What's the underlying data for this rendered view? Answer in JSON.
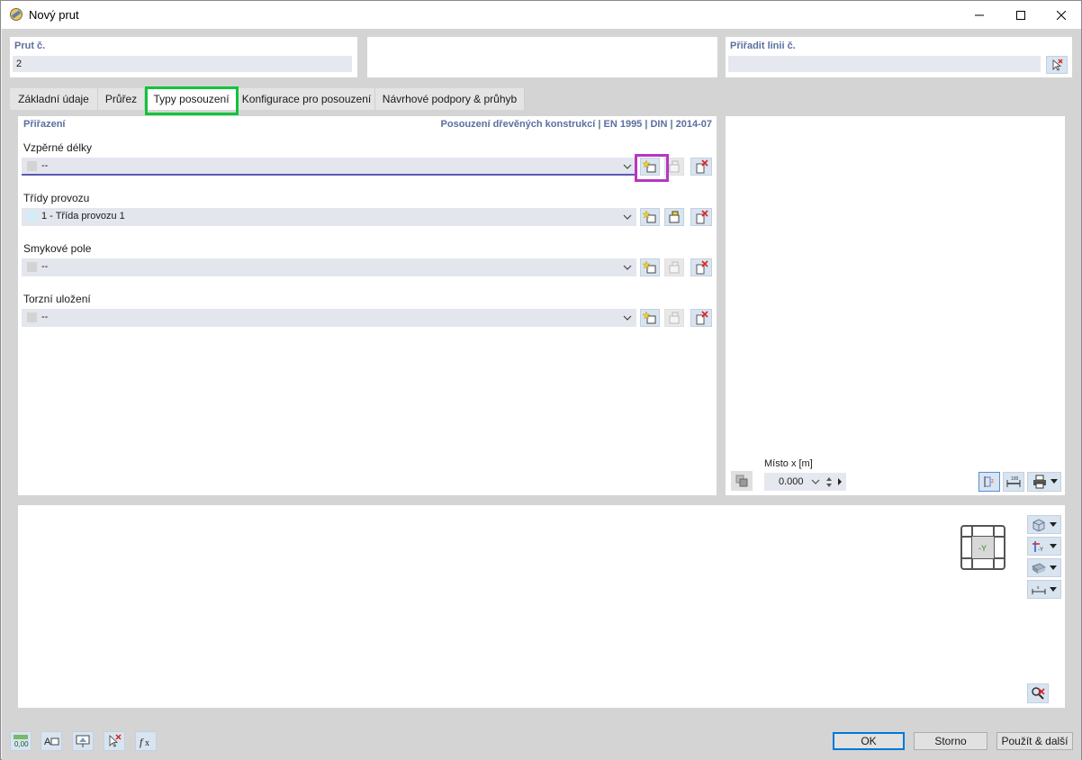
{
  "window": {
    "title": "Nový prut"
  },
  "member_no": {
    "label": "Prut č.",
    "value": "2"
  },
  "assign_line": {
    "label": "Přiřadit linii č.",
    "value": ""
  },
  "tabs": [
    {
      "label": "Základní údaje"
    },
    {
      "label": "Průřez"
    },
    {
      "label": "Typy posouzení"
    },
    {
      "label": "Konfigurace pro posouzení"
    },
    {
      "label": "Návrhové podpory & průhyb"
    }
  ],
  "assignment": {
    "title": "Přiřazení",
    "norm": "Posouzení dřevěných konstrukcí | EN 1995 | DIN | 2014-07",
    "fields": [
      {
        "label": "Vzpěrné délky",
        "value": "--",
        "swatch": "#d3d3d3"
      },
      {
        "label": "Třídy provozu",
        "value": "1 - Třída provozu 1",
        "swatch": "#cfeef8"
      },
      {
        "label": "Smykové pole",
        "value": "--",
        "swatch": "#d3d3d3"
      },
      {
        "label": "Torzní uložení",
        "value": "--",
        "swatch": "#d3d3d3"
      }
    ]
  },
  "location": {
    "label": "Místo x [m]",
    "value": "0.000"
  },
  "view_axis_label": "-Y",
  "buttons": {
    "ok": "OK",
    "cancel": "Storno",
    "apply_next": "Použít & další"
  },
  "footer_icons": [
    "units-icon",
    "text-style-icon",
    "model-view-icon",
    "pick-icon",
    "formula-icon"
  ],
  "colors": {
    "accent_label": "#5a6fa0",
    "highlight_tab": "#10c43a",
    "highlight_button": "#b636c4"
  }
}
